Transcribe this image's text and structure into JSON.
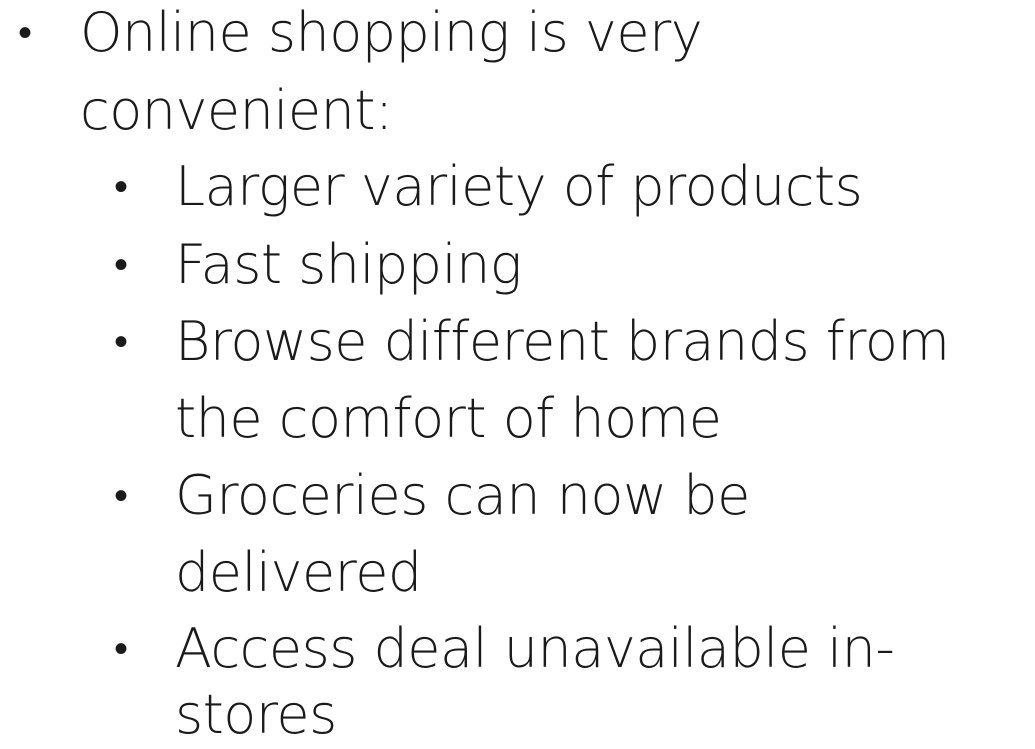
{
  "slide": {
    "bullets": [
      {
        "lines": [
          "Online shopping is very",
          "convenient:"
        ],
        "sub_bullets": [
          {
            "lines": [
              "Larger variety of products"
            ]
          },
          {
            "lines": [
              "Fast shipping"
            ]
          },
          {
            "lines": [
              "Browse different brands from",
              "the comfort of home"
            ]
          },
          {
            "lines": [
              "Groceries can now be",
              "delivered"
            ]
          },
          {
            "lines": [
              "Access deal unavailable in-",
              "stores"
            ]
          }
        ]
      }
    ],
    "bullet_glyph": "•"
  }
}
